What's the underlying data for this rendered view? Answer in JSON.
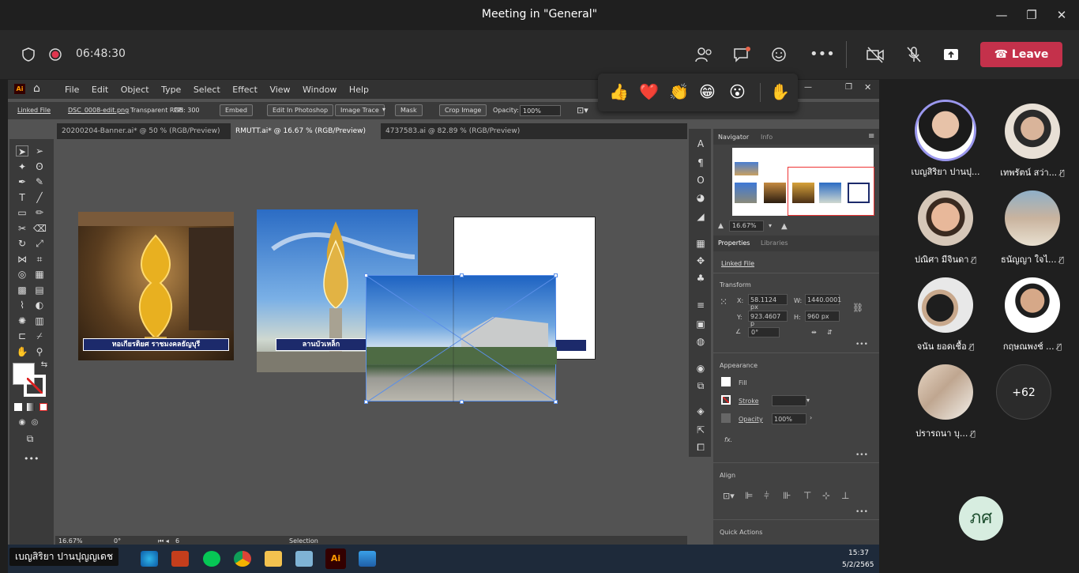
{
  "window": {
    "title": "Meeting in \"General\""
  },
  "meeting": {
    "timer": "06:48:30",
    "leave_label": "Leave"
  },
  "reactions": [
    "👍",
    "❤️",
    "👏",
    "😁",
    "😮",
    "✋"
  ],
  "illustrator": {
    "menu": [
      "File",
      "Edit",
      "Object",
      "Type",
      "Select",
      "Effect",
      "View",
      "Window",
      "Help"
    ],
    "control": {
      "linked_file": "Linked File",
      "filename": "DSC_0008-edit.png",
      "color": "Transparent RGB",
      "ppi": "PPI: 300",
      "embed": "Embed",
      "edit_in_photoshop": "Edit In Photoshop",
      "image_trace": "Image Trace",
      "mask": "Mask",
      "crop_image": "Crop Image",
      "opacity_label": "Opacity:",
      "opacity_value": "100%"
    },
    "tabs": [
      "20200204-Banner.ai* @ 50 % (RGB/Preview)",
      "RMUTT.ai* @ 16.67 % (RGB/Preview)",
      "4737583.ai @ 82.89 % (RGB/Preview)"
    ],
    "canvas": {
      "banner1": "หอเกียรติยศ ราชมงคลธัญบุรี",
      "banner2": "ลานบัวเหล็ก"
    },
    "navigator": {
      "tab1": "Navigator",
      "tab2": "Info",
      "zoom": "16.67%"
    },
    "properties": {
      "tab1": "Properties",
      "tab2": "Libraries",
      "linked_file": "Linked File",
      "transform": "Transform",
      "x_label": "X:",
      "x": "58.1124 px",
      "y_label": "Y:",
      "y": "923.4607 p",
      "w_label": "W:",
      "w": "1440.0001",
      "h_label": "H:",
      "h": "960 px",
      "angle": "0°",
      "appearance": "Appearance",
      "fill": "Fill",
      "stroke": "Stroke",
      "opacity_label": "Opacity",
      "opacity": "100%",
      "fx": "fx.",
      "align": "Align",
      "quick_actions": "Quick Actions"
    },
    "status": {
      "zoom": "16.67%",
      "angle": "0°",
      "artboard": "6",
      "mode": "Selection"
    }
  },
  "taskbar": {
    "time": "15:37",
    "date": "5/2/2565"
  },
  "presenter_caption": "เบญสิริยา ปานปุญญเดช",
  "participants": [
    {
      "name": "เบญสิริยา ปานปุ...",
      "muted": false
    },
    {
      "name": "เทพรัตน์ สว่า...",
      "muted": true
    },
    {
      "name": "ปณิศา มีจินดา",
      "muted": true
    },
    {
      "name": "ธนัญญา ใจไ...",
      "muted": true
    },
    {
      "name": "จนัน ยอดเชื้อ",
      "muted": true
    },
    {
      "name": "กฤษณพงช์ ...",
      "muted": true
    },
    {
      "name": "ปรารถนา บุ...",
      "muted": true
    }
  ],
  "more_participants": "+62",
  "self_initials": "ภศ",
  "colors": {
    "leave": "#c4314b",
    "panel": "#424242",
    "canvas": "#535353"
  }
}
